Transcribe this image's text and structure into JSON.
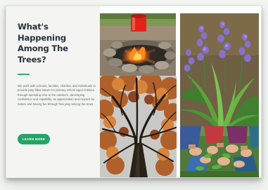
{
  "section": {
    "heading": "What's Happening Among The Trees?",
    "body": "We work with schools, families, charities and individuals to provide play-filled nature for primary school aged children through spending time in the outdoors, developing confidence and capability, an appreciation and respect for nature and having fun through free play among the trees.",
    "cta_label": "Learn more"
  },
  "colors": {
    "accent": "#23a565",
    "heading": "#263238",
    "panel_background": "#f4f5f3"
  },
  "gallery": {
    "photos": [
      "campfire-photo",
      "bluebells-photo",
      "tree-canopy-photo",
      "children-hands-photo"
    ]
  }
}
